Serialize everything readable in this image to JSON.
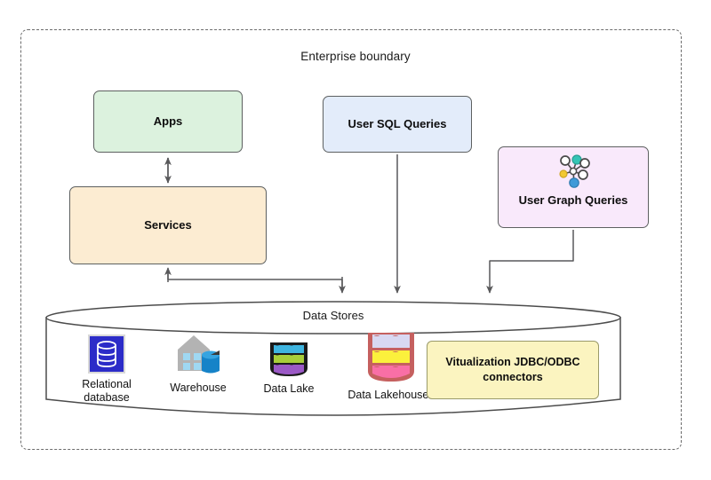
{
  "boundary": {
    "title": "Enterprise boundary"
  },
  "nodes": {
    "apps": {
      "label": "Apps",
      "color": "#dcf2de"
    },
    "services": {
      "label": "Services",
      "color": "#fcecd2"
    },
    "sql_queries": {
      "label": "User SQL  Queries",
      "color": "#e3ecfa"
    },
    "graph_queries": {
      "label": "User Graph Queries",
      "color": "#f9e9fb",
      "icon": "graph-network-icon"
    }
  },
  "data_stores": {
    "title": "Data Stores",
    "items": [
      {
        "label": "Relational\ndatabase",
        "icon": "relational-database-icon"
      },
      {
        "label": "Warehouse",
        "icon": "warehouse-icon"
      },
      {
        "label": "Data Lake",
        "icon": "data-lake-icon"
      },
      {
        "label": "Data Lakehouses",
        "icon": "data-lakehouse-icon"
      }
    ],
    "connectors": {
      "label": "Vitualization JDBC/ODBC connectors",
      "color": "#fbf4c0"
    }
  },
  "colors": {
    "stroke": "#5d6060",
    "boundary_stroke": "#6b6b6b",
    "arrow": "#59595b",
    "graph_node_teal": "#35c4b5",
    "graph_node_blue": "#3f9ad8",
    "graph_node_yellow": "#f2c832",
    "db_square": "#2c2cc8",
    "warehouse_gray": "#b3b3b3",
    "warehouse_window": "#9fd8f2",
    "warehouse_cyl": "#1683c8",
    "lake_body": "#1b1b1b",
    "lake_layer_top": "#3fb5e0",
    "lake_layer_mid": "#a8cf3a",
    "lake_layer_bot": "#9b59c6",
    "lakehouse_body": "#c5605f",
    "lakehouse_layer_top": "#d8d8f2",
    "lakehouse_layer_mid": "#fbf03c",
    "lakehouse_layer_bot": "#f96fa6"
  }
}
